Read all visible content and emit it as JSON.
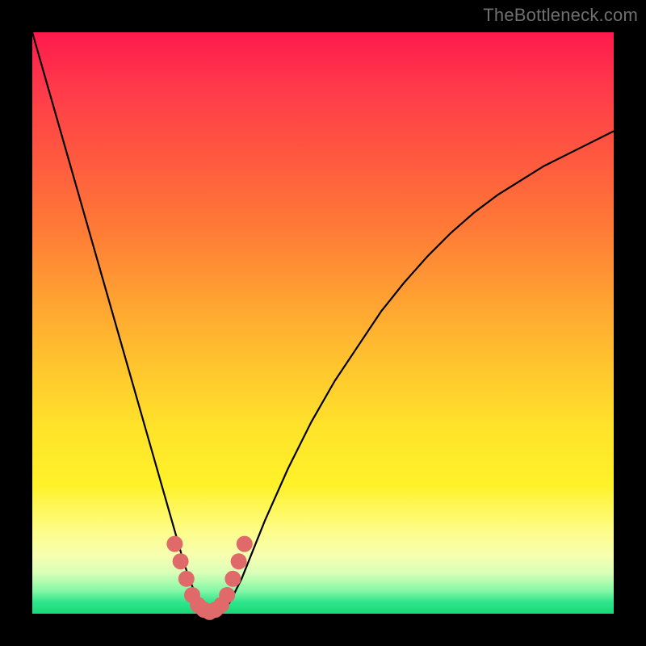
{
  "watermark": "TheBottleneck.com",
  "colors": {
    "background": "#000000",
    "curve_stroke": "#000000",
    "marker_fill": "#e06a6a",
    "marker_stroke": "#c94f4f"
  },
  "chart_data": {
    "type": "line",
    "title": "",
    "xlabel": "",
    "ylabel": "",
    "xlim": [
      0,
      100
    ],
    "ylim": [
      0,
      100
    ],
    "grid": false,
    "series": [
      {
        "name": "bottleneck-curve",
        "x": [
          0,
          2,
          4,
          6,
          8,
          10,
          12,
          14,
          16,
          18,
          20,
          22,
          24,
          26,
          27,
          28,
          29,
          30,
          31,
          32,
          33,
          34,
          36,
          38,
          40,
          44,
          48,
          52,
          56,
          60,
          64,
          68,
          72,
          76,
          80,
          84,
          88,
          92,
          96,
          100
        ],
        "values": [
          100,
          93,
          86,
          79,
          72,
          65,
          58,
          51,
          44,
          37,
          30,
          23,
          16,
          9,
          6,
          3.5,
          1.8,
          0.8,
          0.3,
          0.3,
          0.8,
          2,
          6,
          11,
          16,
          25,
          33,
          40,
          46,
          52,
          57,
          61.5,
          65.5,
          69,
          72,
          74.5,
          77,
          79,
          81,
          83
        ]
      }
    ],
    "markers": {
      "name": "valley-markers",
      "x": [
        24.5,
        25.5,
        26.5,
        27.5,
        28.5,
        29.5,
        30.5,
        31.5,
        32.5,
        33.5,
        34.5,
        35.5,
        36.5
      ],
      "values": [
        12,
        9,
        6,
        3.2,
        1.5,
        0.7,
        0.3,
        0.7,
        1.5,
        3.2,
        6,
        9,
        12
      ],
      "radius": 10
    }
  }
}
